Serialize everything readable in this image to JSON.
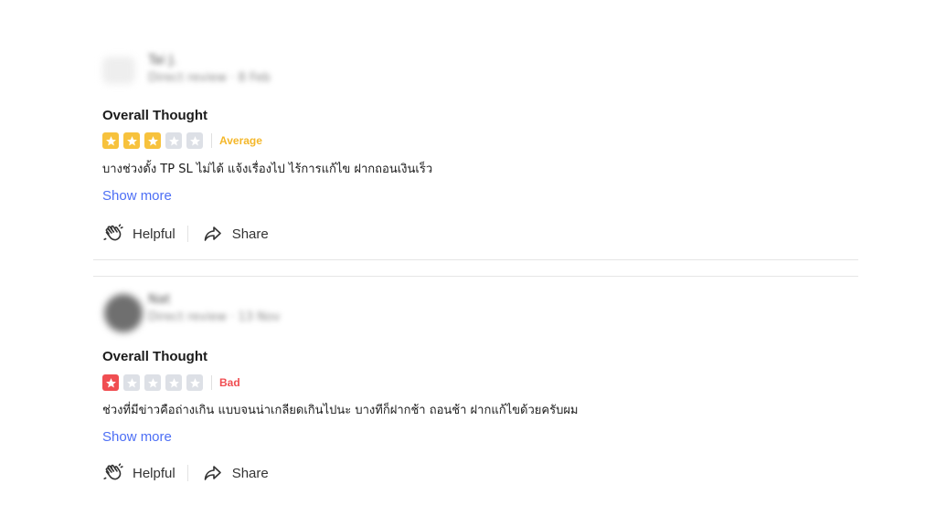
{
  "reviews": [
    {
      "reviewer_name": "Tai J.",
      "reviewer_meta": "Direct review · 8 Feb",
      "title": "Overall Thought",
      "stars_filled": 3,
      "stars_total": 5,
      "rating_label": "Average",
      "rating_color": "#f7c23d",
      "text": "บางช่วงดั้ง TP SL ไม่ได้ แจ้งเรื่องไป ไร้การแก้ไข ฝากถอนเงินเร็ว",
      "show_more": "Show more",
      "helpful_label": "Helpful",
      "share_label": "Share"
    },
    {
      "reviewer_name": "Nat",
      "reviewer_meta": "Direct review · 13 Nov",
      "title": "Overall Thought",
      "stars_filled": 1,
      "stars_total": 5,
      "rating_label": "Bad",
      "rating_color": "#f04e52",
      "text": "ช่วงที่มีข่าวคือถ่างเกิน แบบจนน่าเกลียดเกินไปนะ บางทีก็ฝากช้า ถอนช้า ฝากแก้ไขด้วยครับผม",
      "show_more": "Show more",
      "helpful_label": "Helpful",
      "share_label": "Share"
    }
  ],
  "icons": {
    "star": "star-icon",
    "helpful": "clap-hands-icon",
    "share": "share-arrow-icon"
  },
  "colors": {
    "link": "#4c6ef5",
    "star_empty": "#dde0e6"
  }
}
